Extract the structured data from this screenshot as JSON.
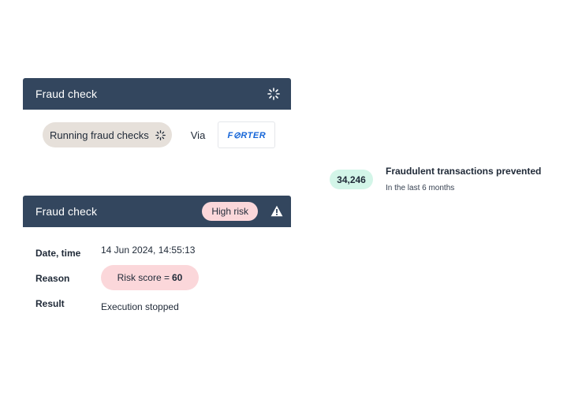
{
  "fraud_check_running": {
    "title": "Fraud check",
    "status_label": "Running fraud checks",
    "via_label": "Via",
    "provider_logo_text": "F⊘RTER",
    "spinner_icon": "spinner-icon"
  },
  "stats": {
    "count": "34,246",
    "title": "Fraudulent transactions prevented",
    "subtitle": "In the last 6 months",
    "badge_color": "#d3f5e8"
  },
  "fraud_check_result": {
    "title": "Fraud check",
    "risk_badge": "High risk",
    "risk_color": "#fbd7da",
    "warning_icon": "warning-icon",
    "details": {
      "date_label": "Date, time",
      "date_value": "14 Jun 2024, 14:55:13",
      "reason_label": "Reason",
      "reason_prefix": "Risk score =",
      "reason_score": "60",
      "result_label": "Result",
      "result_value": "Execution stopped"
    }
  },
  "colors": {
    "header_bg": "#33465e",
    "pill_neutral": "#e6e0da",
    "logo_blue": "#1565d8"
  }
}
